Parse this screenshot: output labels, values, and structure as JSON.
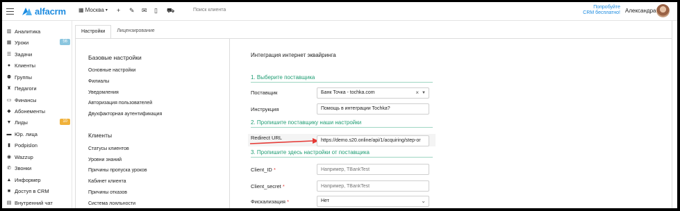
{
  "topbar": {
    "logo_text": "alfacrm",
    "branch": "Москва",
    "search_placeholder": "Поиск клиента",
    "promo_line1": "Попробуйте",
    "promo_line2": "CRM бесплатно!",
    "user_name": "Александра",
    "icons": [
      "plus-icon",
      "wrench-icon",
      "mail-icon",
      "phone-icon",
      "cart-icon"
    ]
  },
  "sidebar": {
    "items": [
      {
        "label": "Аналитика",
        "icon": "chart-icon"
      },
      {
        "label": "Уроки",
        "icon": "calendar-icon",
        "badge": "56",
        "badge_color": "#8bc6df"
      },
      {
        "label": "Задачи",
        "icon": "tasks-icon"
      },
      {
        "label": "Клиенты",
        "icon": "user-icon"
      },
      {
        "label": "Группы",
        "icon": "users-icon"
      },
      {
        "label": "Педагоги",
        "icon": "graduation-cap-icon"
      },
      {
        "label": "Финансы",
        "icon": "money-icon"
      },
      {
        "label": "Абонементы",
        "icon": "ticket-icon"
      },
      {
        "label": "Лиды",
        "icon": "funnel-icon",
        "badge": "10",
        "badge_color": "#f0b13a"
      },
      {
        "label": "Юр. лица",
        "icon": "briefcase-icon"
      },
      {
        "label": "Podpislon",
        "icon": "doc-icon"
      },
      {
        "label": "Wazzup",
        "icon": "whatsapp-icon"
      },
      {
        "label": "Звонки",
        "icon": "phone-icon"
      },
      {
        "label": "Информер",
        "icon": "bell-icon"
      },
      {
        "label": "Доступ в CRM",
        "icon": "lock-icon"
      },
      {
        "label": "Внутренний чат",
        "icon": "chat-icon"
      }
    ]
  },
  "tabs": [
    {
      "label": "Настройки",
      "active": true
    },
    {
      "label": "Лицензирование",
      "active": false
    }
  ],
  "settings": {
    "basic_title": "Базовые настройки",
    "basic_items": [
      "Основные настройки",
      "Филиалы",
      "Уведомления",
      "Авторизация пользователей",
      "Двухфакторная аутентификация"
    ],
    "clients_title": "Клиенты",
    "clients_items": [
      "Статусы клиентов",
      "Уровни знаний",
      "Причины пропуска уроков",
      "Кабинет клиента",
      "Причины отказов",
      "Система лояльности"
    ]
  },
  "form": {
    "title": "Интеграция интернет эквайринга",
    "section1": "1. Выберите поставщика",
    "provider_label": "Поставщик",
    "provider_value": "Банк Точка - tochka.com",
    "instruction_label": "Инструкция",
    "instruction_value": "Помощь в интеграции Tochka?",
    "section2": "2. Пропишите поставщику наши настройки",
    "redirect_label": "Redirect URL",
    "redirect_value": "https://demo.s20.online/api/1/acquiring/step-or",
    "section3": "3. Пропишите здесь настройки от поставщика",
    "client_id_label": "Client_ID",
    "client_id_placeholder": "Например, TBankTest",
    "client_secret_label": "Client_secret",
    "client_secret_placeholder": "Например, TBankTest",
    "fiscal_label": "Фискализация",
    "fiscal_value": "Нет",
    "required_mark": "*"
  },
  "colors": {
    "accent": "#1c8be0",
    "section": "#1f9d73",
    "arrow": "#e53935"
  }
}
